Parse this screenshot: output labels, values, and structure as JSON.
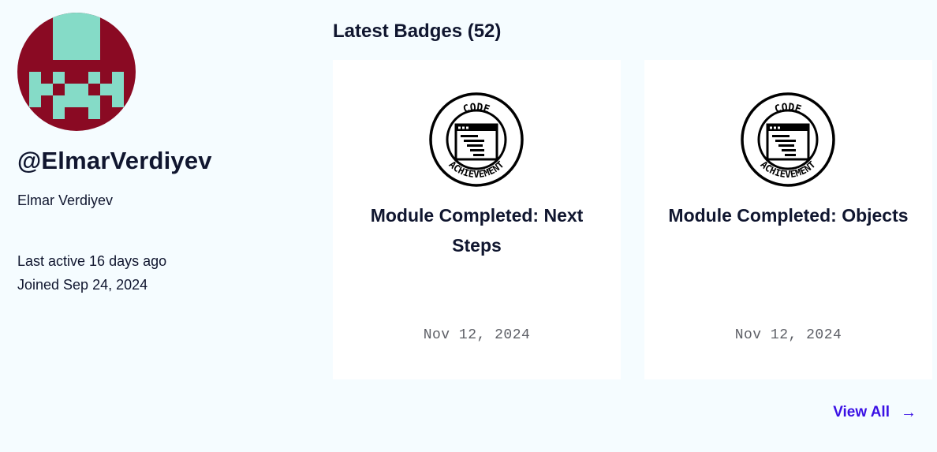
{
  "profile": {
    "username": "@ElmarVerdiyev",
    "full_name": "Elmar Verdiyev",
    "last_active": "Last active 16 days ago",
    "joined": "Joined Sep 24, 2024",
    "avatar_colors": {
      "background": "#8a0a23",
      "pixels": "#85dbc7"
    }
  },
  "badges": {
    "title": "Latest Badges (52)",
    "items": [
      {
        "icon": "code-achievement-badge-icon",
        "badge_top_text": "CODE",
        "badge_bottom_text": "ACHIEVEMENT",
        "title": "Module Completed: Next Steps",
        "date": "Nov 12, 2024"
      },
      {
        "icon": "code-achievement-badge-icon",
        "badge_top_text": "CODE",
        "badge_bottom_text": "ACHIEVEMENT",
        "title": "Module Completed: Objects",
        "date": "Nov 12, 2024"
      }
    ],
    "view_all_label": "View All",
    "view_all_icon": "arrow-right-icon",
    "view_all_arrow": "→"
  },
  "colors": {
    "page_background": "#f5fcff",
    "text": "#10162f",
    "link": "#3a10e5",
    "date": "#5d5f66"
  }
}
